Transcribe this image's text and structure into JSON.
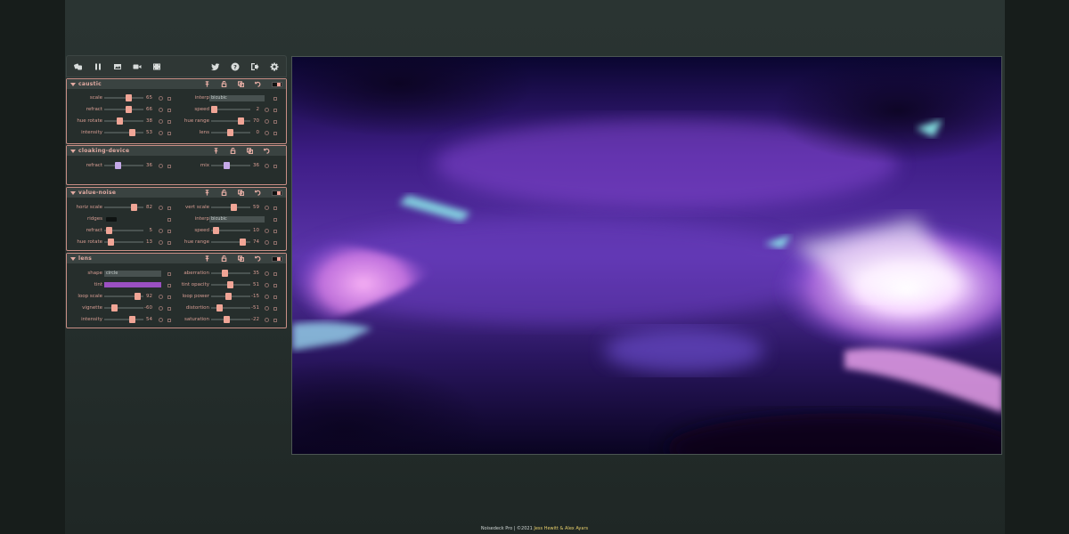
{
  "toolbar": {
    "left_icons": [
      "dice-icon",
      "pause-icon",
      "image-icon",
      "video-icon",
      "film-icon"
    ],
    "right_icons": [
      "twitter-icon",
      "help-icon",
      "share-icon",
      "gear-icon"
    ]
  },
  "panels": [
    {
      "name": "caustic",
      "controls": {
        "scale": {
          "label": "scale",
          "value": "65"
        },
        "refract": {
          "label": "refract",
          "value": "66"
        },
        "hue_rotate": {
          "label": "hue rotate",
          "value": "38"
        },
        "intensity": {
          "label": "intensity",
          "value": "53"
        },
        "interp": {
          "label": "interp",
          "value": "bicubic"
        },
        "speed": {
          "label": "speed",
          "value": "2"
        },
        "hue_range": {
          "label": "hue range",
          "value": "70"
        },
        "lens": {
          "label": "lens",
          "value": "0"
        }
      }
    },
    {
      "name": "cloaking-device",
      "controls": {
        "refract": {
          "label": "refract",
          "value": "36"
        },
        "mix": {
          "label": "mix",
          "value": "36"
        }
      }
    },
    {
      "name": "value-noise",
      "controls": {
        "horiz_scale": {
          "label": "horiz scale",
          "value": "82"
        },
        "ridges": {
          "label": "ridges"
        },
        "refract": {
          "label": "refract",
          "value": "5"
        },
        "hue_rotate": {
          "label": "hue rotate",
          "value": "13"
        },
        "vert_scale": {
          "label": "vert scale",
          "value": "59"
        },
        "interp": {
          "label": "interp",
          "value": "bicubic"
        },
        "speed": {
          "label": "speed",
          "value": "10"
        },
        "hue_range": {
          "label": "hue range",
          "value": "74"
        }
      }
    },
    {
      "name": "lens",
      "controls": {
        "shape": {
          "label": "shape",
          "value": "circle"
        },
        "tint": {
          "label": "tint",
          "color": "#9b50c2"
        },
        "loop_scale": {
          "label": "loop scale",
          "value": "92"
        },
        "vignette": {
          "label": "vignette",
          "value": "-60"
        },
        "intensity": {
          "label": "intensity",
          "value": "54"
        },
        "aberration": {
          "label": "aberration",
          "value": "35"
        },
        "tint_opacity": {
          "label": "tint opacity",
          "value": "51"
        },
        "loop_power": {
          "label": "loop power",
          "value": "-15"
        },
        "distortion": {
          "label": "distortion",
          "value": "-51"
        },
        "saturation": {
          "label": "saturation",
          "value": "-22"
        }
      }
    }
  ],
  "footer": {
    "text": "Noisedeck Pro | ©2021",
    "credit": "Jess Hewitt & Alex Ayars"
  },
  "colors": {
    "accent": "#e2aba2",
    "knob": "#f0a596",
    "knob_alt": "#c5a9e8",
    "tint": "#9b50c2",
    "credit": "#e7cf6b"
  }
}
